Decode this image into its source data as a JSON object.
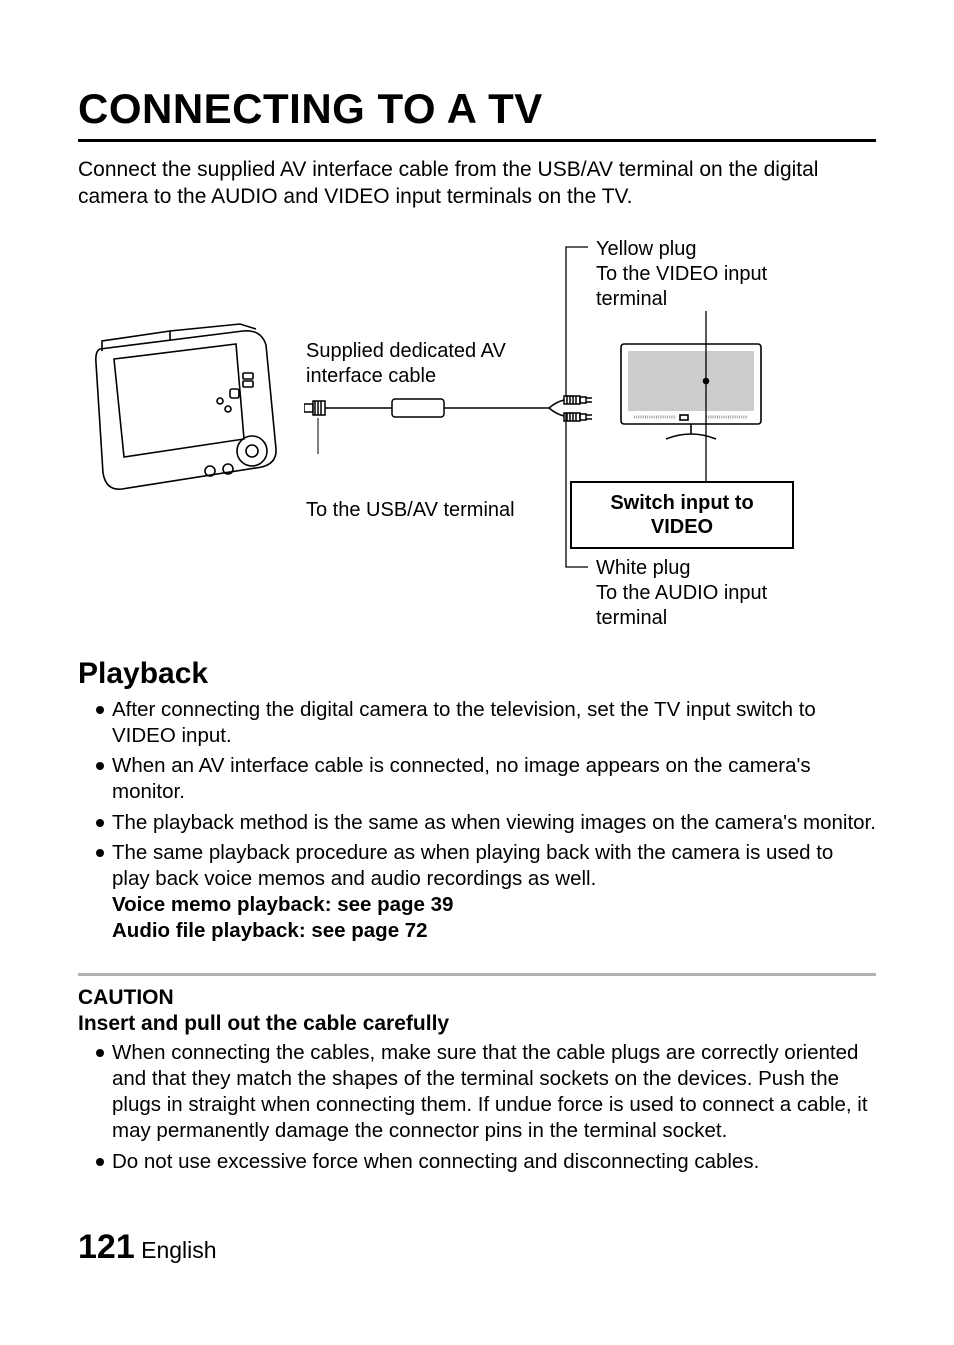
{
  "title": "CONNECTING TO A TV",
  "intro": "Connect the supplied AV interface cable from the USB/AV terminal on the digital camera to the AUDIO and VIDEO input terminals on the TV.",
  "diagram": {
    "cable_label_1": "Supplied dedicated AV",
    "cable_label_2": "interface cable",
    "usb_label": "To the USB/AV terminal",
    "yellow_plug_1": "Yellow plug",
    "yellow_plug_2": "To the VIDEO input",
    "yellow_plug_3": "terminal",
    "switch_1": "Switch input to",
    "switch_2": "VIDEO",
    "white_plug_1": "White plug",
    "white_plug_2": "To the AUDIO input",
    "white_plug_3": "terminal"
  },
  "playback": {
    "heading": "Playback",
    "b1": "After connecting the digital camera to the television, set the TV input switch to VIDEO input.",
    "b2": "When an AV interface cable is connected, no image appears on the camera's monitor.",
    "b3": "The playback method is the same as when viewing images on the camera's monitor.",
    "b4": "The same playback procedure as when playing back with the camera is used to play back voice memos and audio recordings as well.",
    "b4_sub1": "Voice memo playback: see page 39",
    "b4_sub2": "Audio file playback: see page 72"
  },
  "caution": {
    "heading": "CAUTION",
    "sub": "Insert and pull out the cable carefully",
    "b1": "When connecting the cables, make sure that the cable plugs are correctly oriented and that they match the shapes of the terminal sockets on the devices. Push the plugs in straight when connecting them. If undue force is used to connect a cable, it may permanently damage the connector pins in the terminal socket.",
    "b2": "Do not use excessive force when connecting and disconnecting cables."
  },
  "footer": {
    "page": "121",
    "lang": "English"
  }
}
